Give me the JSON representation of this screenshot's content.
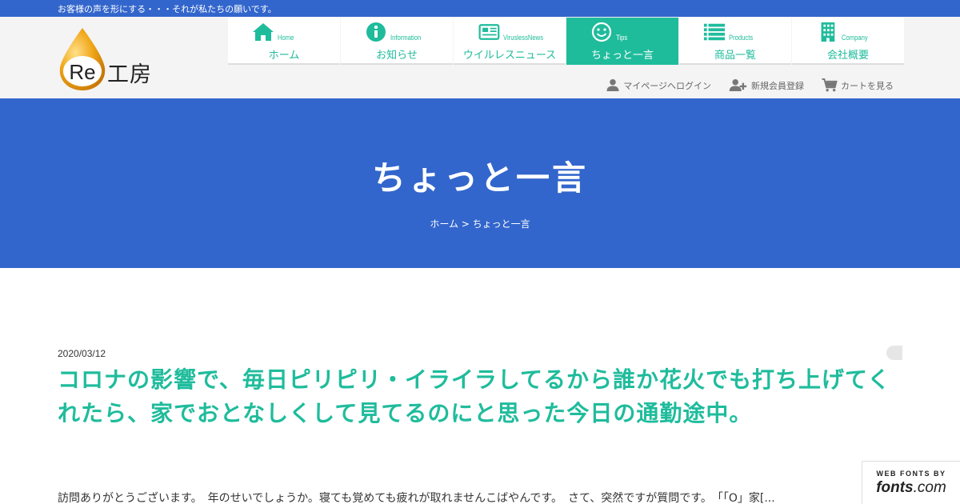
{
  "topbar": {
    "tagline": "お客様の声を形にする・・・それが私たちの願いです。"
  },
  "logo": {
    "text": "Re工房",
    "icon": "drop-logo-icon"
  },
  "nav": {
    "items": [
      {
        "en": "Home",
        "jp": "ホーム",
        "icon": "home-icon",
        "active": false
      },
      {
        "en": "Information",
        "jp": "お知らせ",
        "icon": "info-icon",
        "active": false
      },
      {
        "en": "ViruslessNews",
        "jp": "ウイルレスニュース",
        "icon": "newspaper-icon",
        "active": false
      },
      {
        "en": "Tips",
        "jp": "ちょっと一言",
        "icon": "smile-icon",
        "active": true
      },
      {
        "en": "Products",
        "jp": "商品一覧",
        "icon": "list-icon",
        "active": false
      },
      {
        "en": "Company",
        "jp": "会社概要",
        "icon": "building-icon",
        "active": false
      }
    ]
  },
  "util": {
    "mypage": "マイページへログイン",
    "register": "新規会員登録",
    "cart": "カートを見る"
  },
  "hero": {
    "title": "ちょっと一言",
    "breadcrumb_home": "ホーム",
    "breadcrumb_sep": " > ",
    "breadcrumb_current": "ちょっと一言"
  },
  "post": {
    "date": "2020/03/12",
    "title": "コロナの影響で、毎日ピリピリ・イライラしてるから誰か花火でも打ち上げてくれたら、家でおとなしくして見てるのにと思った今日の通勤途中。",
    "body": "訪問ありがとうございます。　年のせいでしょうか。寝ても覚めても疲れが取れませんこばやんです。　さて、突然ですが質問です。　「「O」家[..."
  },
  "badge": {
    "top": "WEB FONTS BY",
    "logo_bold": "fonts",
    "logo_rest": ".com"
  },
  "colors": {
    "primary_blue": "#3366cc",
    "accent_teal": "#1fbc9c"
  }
}
